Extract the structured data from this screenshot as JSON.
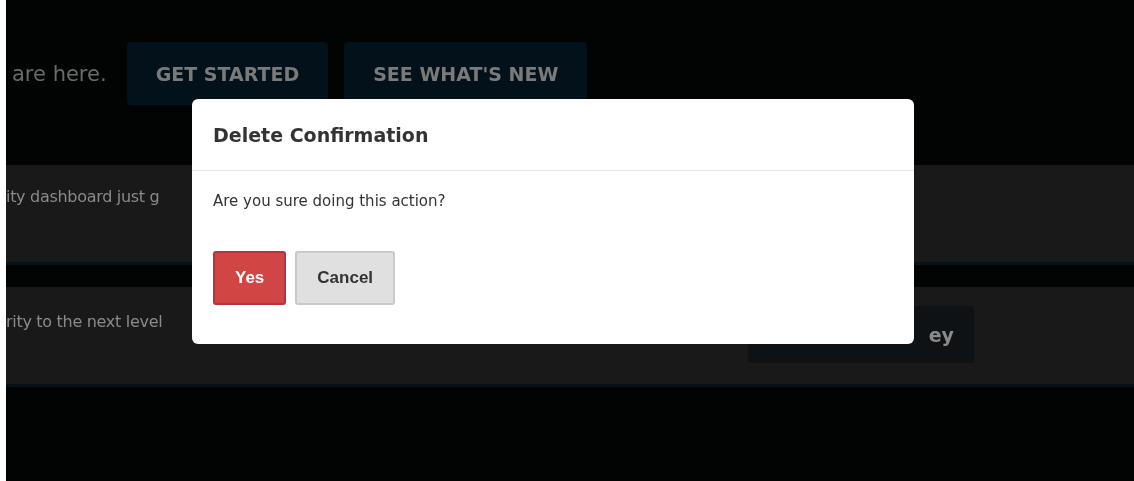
{
  "hero": {
    "text": "are here.",
    "buttons": [
      "GET STARTED",
      "SEE WHAT'S NEW"
    ]
  },
  "bands": [
    {
      "text": "ity dashboard just g"
    },
    {
      "text": "rity to the next level",
      "button": "ey"
    }
  ],
  "dialog": {
    "title": "Delete Confirmation",
    "message": "Are you sure doing this action?",
    "buttons": [
      {
        "label": "Yes",
        "kind": "danger"
      },
      {
        "label": "Cancel",
        "kind": "default"
      }
    ]
  }
}
